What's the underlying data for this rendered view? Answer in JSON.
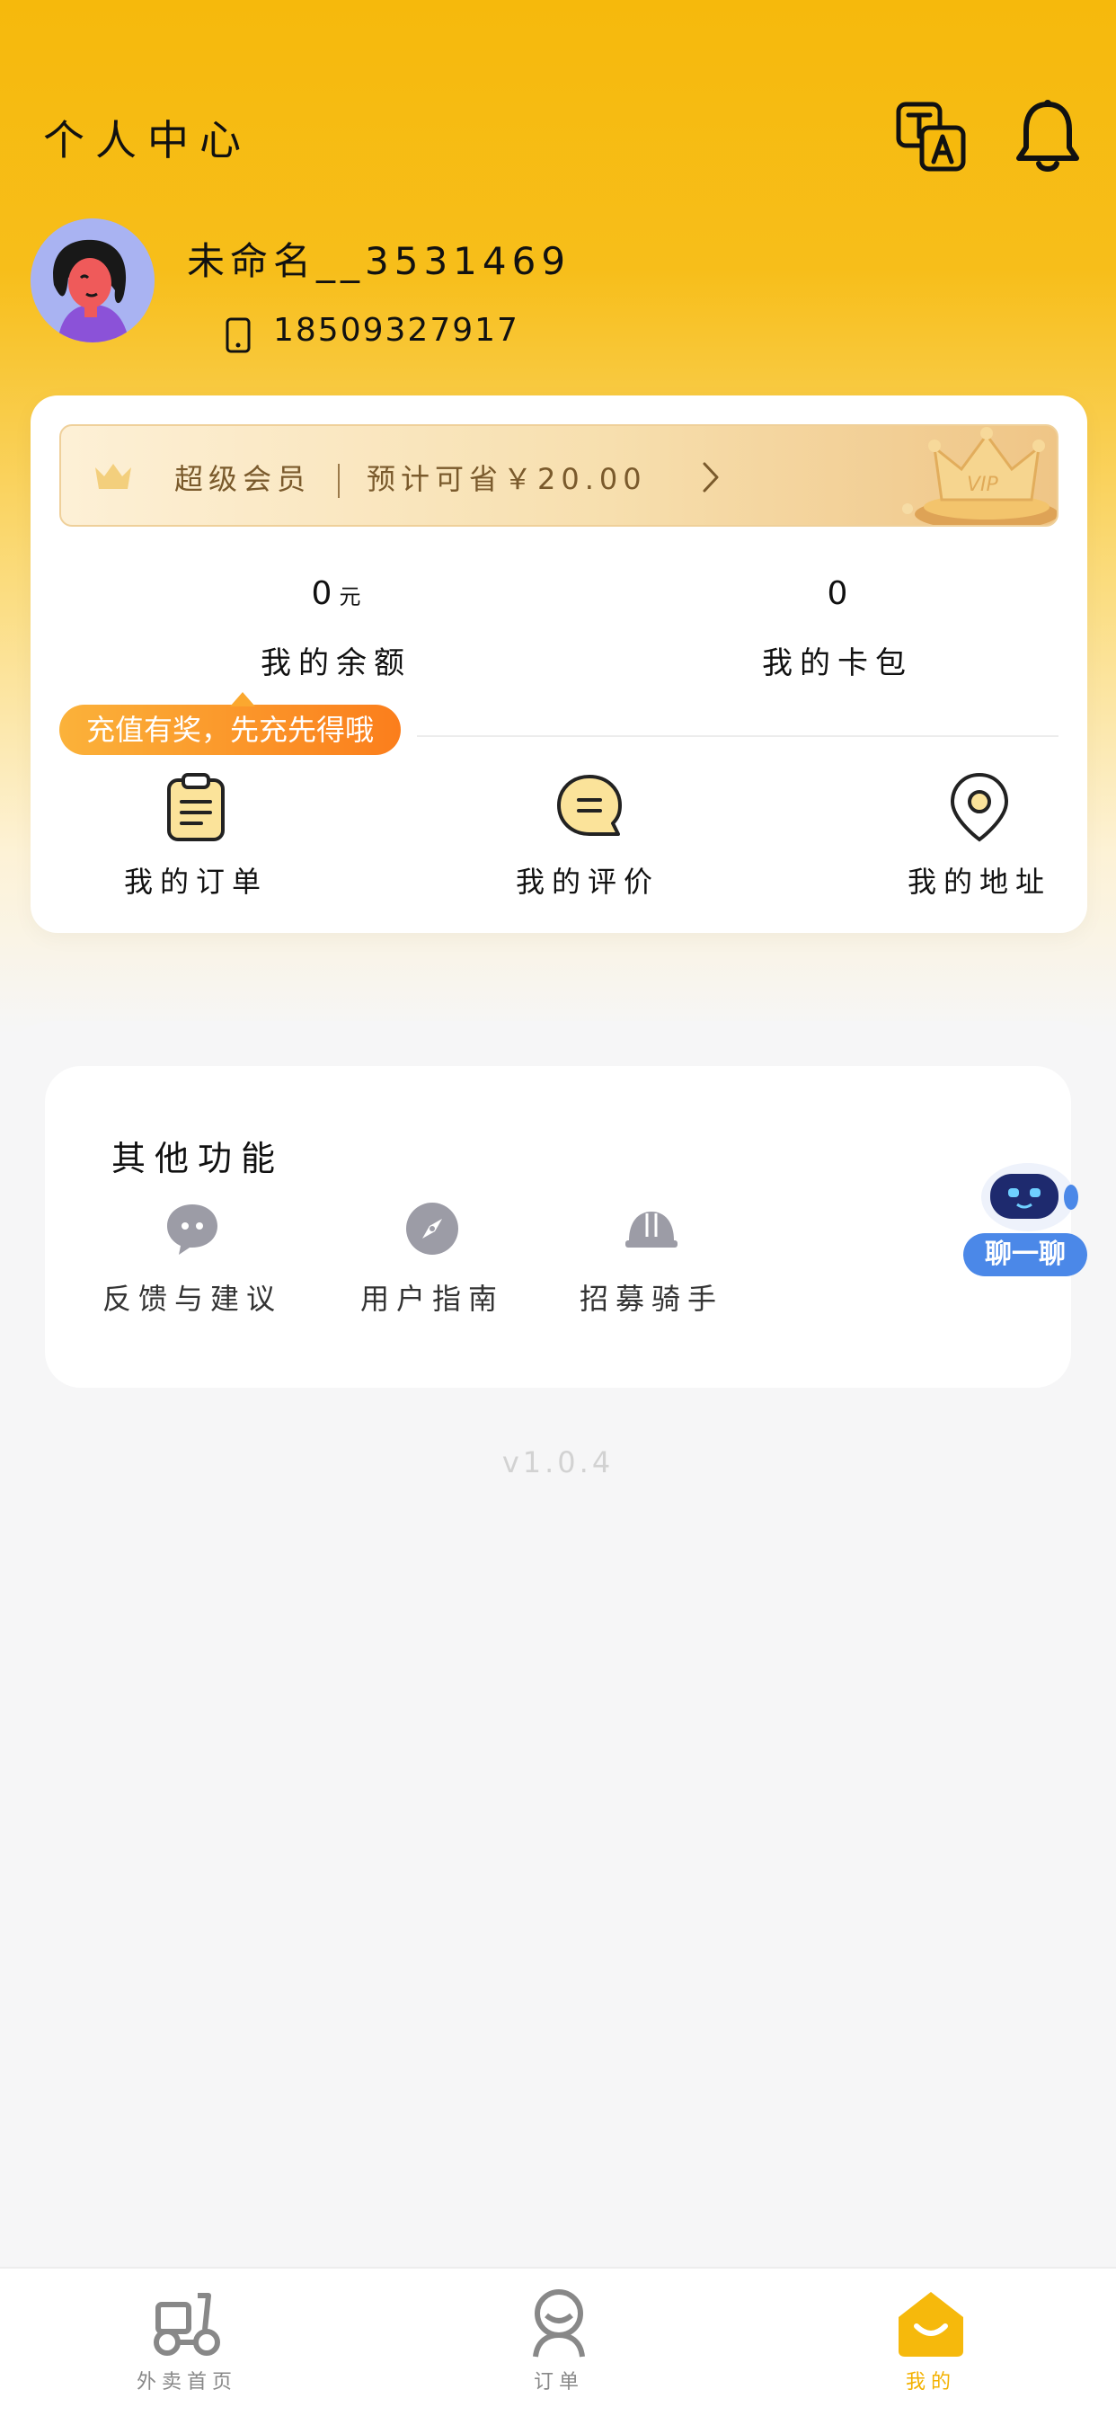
{
  "header": {
    "title": "个人中心",
    "translate_icon": "translate-icon",
    "bell_icon": "bell-icon"
  },
  "profile": {
    "username": "未命名__3531469",
    "phone": "18509327917",
    "avatar_icon": "avatar-illustration"
  },
  "vip": {
    "label": "超级会员",
    "savings_text": "预计可省￥20.00",
    "badge_text": "VIP"
  },
  "stats": {
    "balance_value": "0",
    "balance_unit": "元",
    "balance_label": "我的余额",
    "cards_value": "0",
    "cards_label": "我的卡包"
  },
  "promo_tip": "充值有奖，先充先得哦",
  "quick_actions": [
    {
      "label": "我的订单",
      "icon": "clipboard-icon"
    },
    {
      "label": "我的评价",
      "icon": "chat-bubble-icon"
    },
    {
      "label": "我的地址",
      "icon": "location-pin-icon"
    }
  ],
  "other": {
    "title": "其他功能",
    "features": [
      {
        "label": "反馈与建议",
        "icon": "feedback-icon"
      },
      {
        "label": "用户指南",
        "icon": "compass-icon"
      },
      {
        "label": "招募骑手",
        "icon": "helmet-icon"
      }
    ]
  },
  "chat_bot": {
    "label": "聊一聊"
  },
  "version": "v1.0.4",
  "tabbar": [
    {
      "label": "外卖首页",
      "icon": "scooter-icon",
      "active": false
    },
    {
      "label": "订单",
      "icon": "rider-icon",
      "active": false
    },
    {
      "label": "我的",
      "icon": "smile-house-icon",
      "active": true
    }
  ],
  "colors": {
    "brand_yellow": "#f6b90c",
    "promo_orange": "#fb7e1c",
    "chat_blue": "#4b88e8",
    "active_tab": "#f3b100"
  }
}
